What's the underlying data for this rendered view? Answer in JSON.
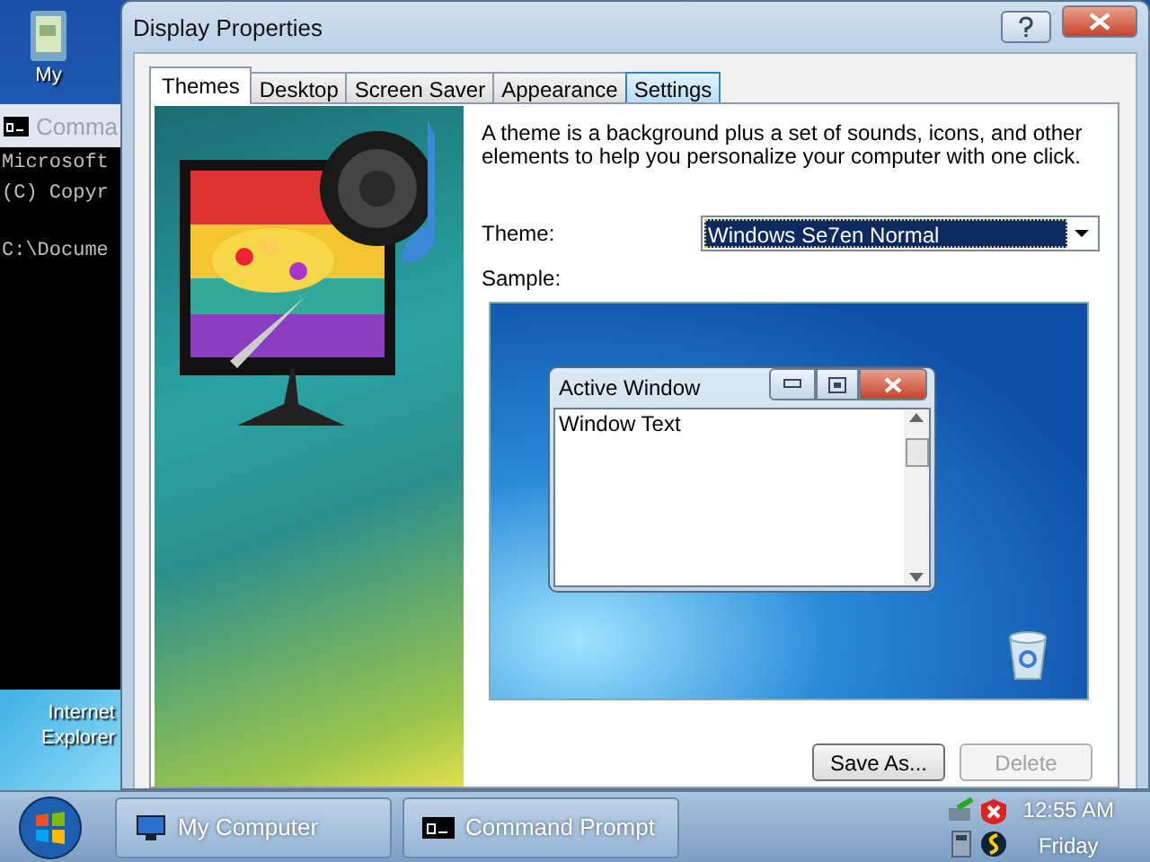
{
  "desktop": {
    "icons": [
      {
        "label": "My"
      },
      {
        "label": "Internet Explorer"
      }
    ]
  },
  "console_window": {
    "title": "Comma",
    "lines": [
      "Microsoft",
      "(C) Copyr",
      "C:\\Docume"
    ]
  },
  "dialog": {
    "title": "Display Properties",
    "tabs": [
      {
        "label": "Themes",
        "selected": true,
        "hovered": false
      },
      {
        "label": "Desktop",
        "selected": false,
        "hovered": false
      },
      {
        "label": "Screen Saver",
        "selected": false,
        "hovered": false
      },
      {
        "label": "Appearance",
        "selected": false,
        "hovered": false
      },
      {
        "label": "Settings",
        "selected": false,
        "hovered": true
      }
    ],
    "description": "A theme is a background plus a set of sounds, icons, and other elements to help you personalize your computer with one click.",
    "theme_label": "Theme:",
    "theme_value": "Windows Se7en Normal",
    "sample_label": "Sample:",
    "preview": {
      "window_title": "Active Window",
      "window_text": "Window Text"
    },
    "buttons": [
      {
        "label": "Save As...",
        "disabled": false
      },
      {
        "label": "Delete",
        "disabled": true
      }
    ]
  },
  "taskbar": {
    "tasks": [
      {
        "label": "My Computer",
        "kind": "computer"
      },
      {
        "label": "Command Prompt",
        "kind": "console"
      }
    ],
    "clock": {
      "time": "12:55 AM",
      "day": "Friday"
    }
  }
}
